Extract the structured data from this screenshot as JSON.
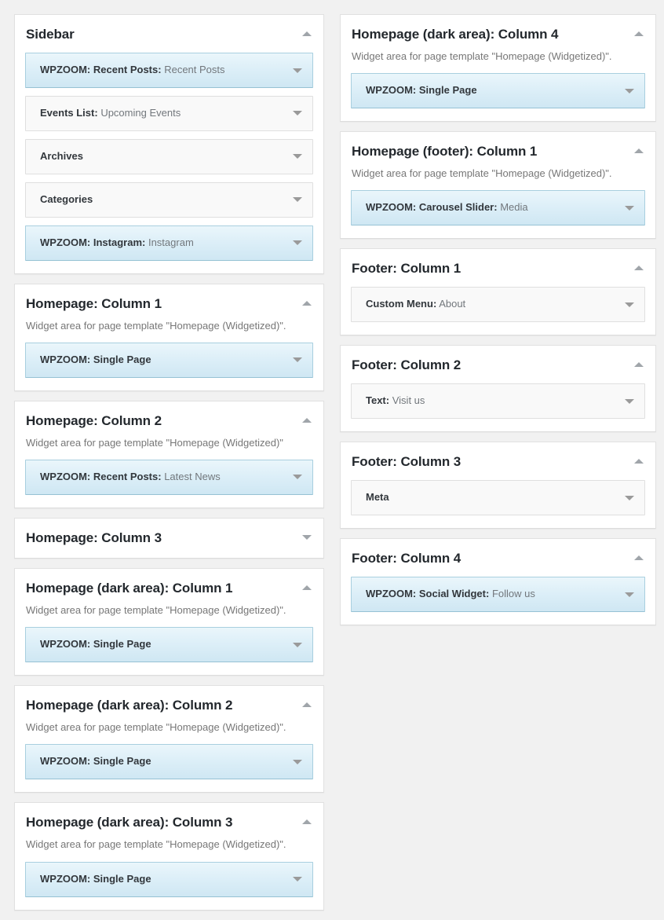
{
  "colors": {
    "page_background": "#f1f1f1",
    "panel_background": "#ffffff",
    "widget_highlight_top": "#eaf6fb",
    "widget_highlight_bottom": "#cfe7f3",
    "widget_highlight_border": "#a8cfdf",
    "widget_plain_background": "#f9f9f9",
    "widget_plain_border": "#dfdfdf",
    "title_text": "#23282d",
    "description_text": "#777777",
    "instance_title_text": "#72777c",
    "chevron": "#a0a5aa"
  },
  "icons": {
    "collapse": "chevron-up-icon",
    "expand": "chevron-down-icon",
    "widget_expand": "chevron-down-icon"
  },
  "left_column": [
    {
      "title": "Sidebar",
      "description": "",
      "collapsed": false,
      "widgets": [
        {
          "name": "WPZOOM: Recent Posts:",
          "instance": "Recent Posts",
          "highlight": true
        },
        {
          "name": "Events List:",
          "instance": "Upcoming Events",
          "highlight": false
        },
        {
          "name": "Archives",
          "instance": "",
          "highlight": false
        },
        {
          "name": "Categories",
          "instance": "",
          "highlight": false
        },
        {
          "name": "WPZOOM: Instagram:",
          "instance": "Instagram",
          "highlight": true
        }
      ]
    },
    {
      "title": "Homepage: Column 1",
      "description": "Widget area for page template \"Homepage (Widgetized)\".",
      "collapsed": false,
      "widgets": [
        {
          "name": "WPZOOM: Single Page",
          "instance": "",
          "highlight": true
        }
      ]
    },
    {
      "title": "Homepage: Column 2",
      "description": "Widget area for page template \"Homepage (Widgetized)\"",
      "collapsed": false,
      "widgets": [
        {
          "name": "WPZOOM: Recent Posts:",
          "instance": "Latest News",
          "highlight": true
        }
      ]
    },
    {
      "title": "Homepage: Column 3",
      "description": "",
      "collapsed": true,
      "widgets": []
    },
    {
      "title": "Homepage (dark area): Column 1",
      "description": "Widget area for page template \"Homepage (Widgetized)\".",
      "collapsed": false,
      "widgets": [
        {
          "name": "WPZOOM: Single Page",
          "instance": "",
          "highlight": true
        }
      ]
    },
    {
      "title": "Homepage (dark area): Column 2",
      "description": "Widget area for page template \"Homepage (Widgetized)\".",
      "collapsed": false,
      "widgets": [
        {
          "name": "WPZOOM: Single Page",
          "instance": "",
          "highlight": true
        }
      ]
    },
    {
      "title": "Homepage (dark area): Column 3",
      "description": "Widget area for page template \"Homepage (Widgetized)\".",
      "collapsed": false,
      "widgets": [
        {
          "name": "WPZOOM: Single Page",
          "instance": "",
          "highlight": true
        }
      ]
    }
  ],
  "right_column": [
    {
      "title": "Homepage (dark area): Column 4",
      "description": "Widget area for page template \"Homepage (Widgetized)\".",
      "collapsed": false,
      "widgets": [
        {
          "name": "WPZOOM: Single Page",
          "instance": "",
          "highlight": true
        }
      ]
    },
    {
      "title": "Homepage (footer): Column 1",
      "description": "Widget area for page template \"Homepage (Widgetized)\".",
      "collapsed": false,
      "widgets": [
        {
          "name": "WPZOOM: Carousel Slider:",
          "instance": "Media",
          "highlight": true
        }
      ]
    },
    {
      "title": "Footer: Column 1",
      "description": "",
      "collapsed": false,
      "widgets": [
        {
          "name": "Custom Menu:",
          "instance": "About",
          "highlight": false
        }
      ]
    },
    {
      "title": "Footer: Column 2",
      "description": "",
      "collapsed": false,
      "widgets": [
        {
          "name": "Text:",
          "instance": "Visit us",
          "highlight": false
        }
      ]
    },
    {
      "title": "Footer: Column 3",
      "description": "",
      "collapsed": false,
      "widgets": [
        {
          "name": "Meta",
          "instance": "",
          "highlight": false
        }
      ]
    },
    {
      "title": "Footer: Column 4",
      "description": "",
      "collapsed": false,
      "widgets": [
        {
          "name": "WPZOOM: Social Widget:",
          "instance": "Follow us",
          "highlight": true
        }
      ]
    }
  ]
}
